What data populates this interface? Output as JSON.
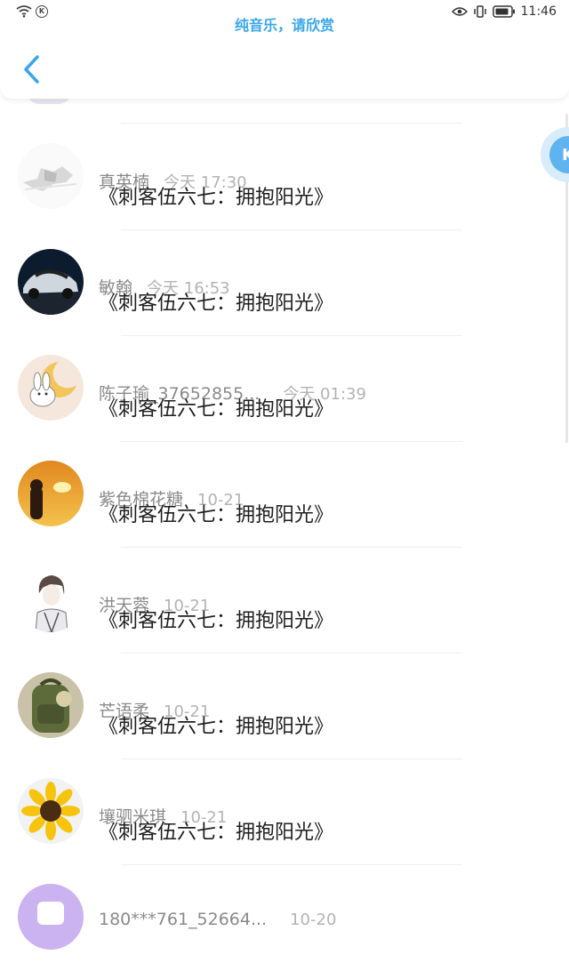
{
  "status_bar": {
    "time": "11:46",
    "icons": [
      "wifi-icon",
      "k-badge-icon",
      "eye-icon",
      "vibrate-icon",
      "battery-icon"
    ]
  },
  "now_playing": "纯音乐，请欣赏",
  "colors": {
    "accent": "#3aa6e8",
    "name": "#8a8a8a",
    "time": "#b3b3b3"
  },
  "items": [
    {
      "name": "真英楠",
      "time": "今天 17:30",
      "title": "《刺客伍六七：拥抱阳光》",
      "avatar": "sketch"
    },
    {
      "name": "敏翰",
      "time": "今天 16:53",
      "title": "《刺客伍六七：拥抱阳光》",
      "avatar": "car"
    },
    {
      "name": "陈子瑜_37652855...",
      "time": "今天 01:39",
      "title": "《刺客伍六七：拥抱阳光》",
      "avatar": "bunny-moon"
    },
    {
      "name": "紫色棉花糖",
      "time": "10-21",
      "title": "《刺客伍六七：拥抱阳光》",
      "avatar": "sunset-girl"
    },
    {
      "name": "洪天蓉",
      "time": "10-21",
      "title": "《刺客伍六七：拥抱阳光》",
      "avatar": "anime-boy"
    },
    {
      "name": "芒语柔",
      "time": "10-21",
      "title": "《刺客伍六七：拥抱阳光》",
      "avatar": "backpack"
    },
    {
      "name": "壤驷米琪",
      "time": "10-21",
      "title": "《刺客伍六七：拥抱阳光》",
      "avatar": "sunflower"
    },
    {
      "name": "180***761_52664...",
      "time": "10-20",
      "title": "",
      "avatar": "purple"
    }
  ]
}
